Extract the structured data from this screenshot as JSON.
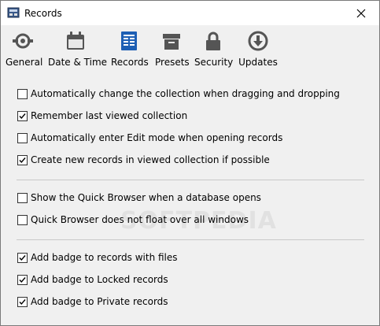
{
  "window": {
    "title": "Records"
  },
  "toolbar": {
    "tabs": [
      {
        "label": "General",
        "icon": "general-icon"
      },
      {
        "label": "Date & Time",
        "icon": "calendar-icon"
      },
      {
        "label": "Records",
        "icon": "records-icon",
        "selected": true
      },
      {
        "label": "Presets",
        "icon": "presets-icon"
      },
      {
        "label": "Security",
        "icon": "lock-icon"
      },
      {
        "label": "Updates",
        "icon": "updates-icon"
      }
    ]
  },
  "options": {
    "group1": [
      {
        "label": "Automatically change the collection when dragging and dropping",
        "checked": false
      },
      {
        "label": "Remember last viewed collection",
        "checked": true
      },
      {
        "label": "Automatically enter Edit mode when opening records",
        "checked": false
      },
      {
        "label": "Create new records in viewed collection if possible",
        "checked": true
      }
    ],
    "group2": [
      {
        "label": "Show the Quick Browser when a database opens",
        "checked": false
      },
      {
        "label": "Quick Browser does not float over all windows",
        "checked": false
      }
    ],
    "group3": [
      {
        "label": "Add badge to records with files",
        "checked": true
      },
      {
        "label": "Add badge to Locked records",
        "checked": true
      },
      {
        "label": "Add badge to Private records",
        "checked": true
      }
    ]
  },
  "watermark": "SOFTPEDIA",
  "colors": {
    "accent": "#1e5fb4",
    "icon_gray": "#555555"
  }
}
